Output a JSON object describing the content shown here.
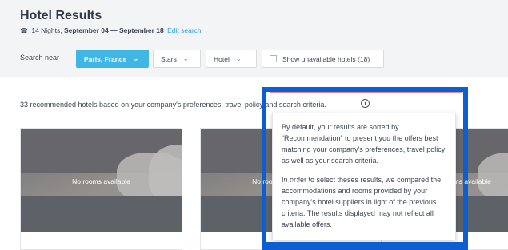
{
  "header": {
    "title": "Hotel Results",
    "phone_icon": "phone-icon",
    "nights": "14 Nights,",
    "dates": "September 04 — September 18",
    "edit_link": "Edit search"
  },
  "filters": {
    "search_label": "Search near",
    "location_value": "Paris, France",
    "stars_label": "Stars",
    "hotel_label": "Hotel",
    "show_unavailable_label": "Show unavailable hotels (18)",
    "accent_color": "#3fb6e3"
  },
  "results": {
    "summary_text": "33 recommended hotels based on your company's preferences, travel policy and search criteria.",
    "info_icon_glyph": "i",
    "cards": [
      {
        "status": "No rooms available"
      },
      {
        "status": "No rooms available"
      },
      {
        "status": "No rooms available"
      }
    ]
  },
  "tooltip": {
    "paragraph1": "By default, your results are sorted by “Recommendation” to present you the offers best matching your company's preferences, travel policy as well as your search criteria.",
    "paragraph2": "In order to select theses results, we compared the accommodations and rooms provided by your company's hotel suppliers in light of the previous criteria. The results displayed may not reflect all available offers."
  },
  "highlight_color": "#0b5fd1"
}
